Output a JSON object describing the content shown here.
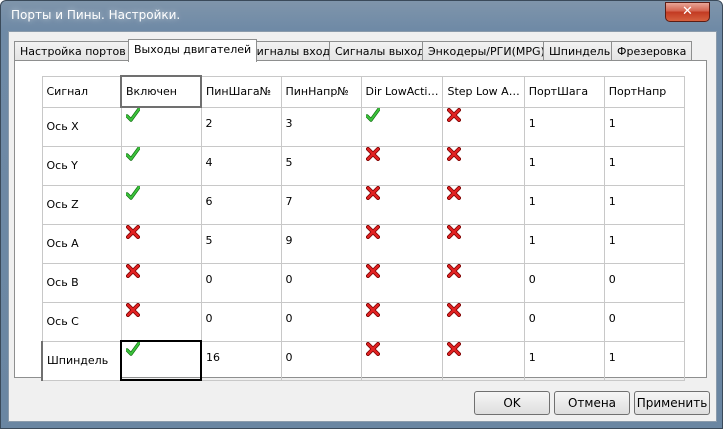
{
  "window": {
    "title": "Порты и Пины.  Настройки.",
    "close_label": "✕"
  },
  "tabs": [
    {
      "label": "Настройка портов",
      "active": false
    },
    {
      "label": "Выходы двигателей",
      "active": true
    },
    {
      "label": "Сигналы входа",
      "active": false
    },
    {
      "label": "Сигналы выхода",
      "active": false
    },
    {
      "label": "Энкодеры/РГИ(MPG)",
      "active": false
    },
    {
      "label": "Шпиндель",
      "active": false
    },
    {
      "label": "Фрезеровка",
      "active": false
    }
  ],
  "table": {
    "columns": [
      "Сигнал",
      "Включен",
      "ПинШага№",
      "ПинНапр№",
      "Dir LowActi…",
      "Step Low A…",
      "ПортШага",
      "ПортНапр"
    ],
    "rows": [
      {
        "signal": "Ось X",
        "enabled": true,
        "step_pin": "2",
        "dir_pin": "3",
        "dir_low": true,
        "step_low": false,
        "step_port": "1",
        "dir_port": "1"
      },
      {
        "signal": "Ось Y",
        "enabled": true,
        "step_pin": "4",
        "dir_pin": "5",
        "dir_low": false,
        "step_low": false,
        "step_port": "1",
        "dir_port": "1"
      },
      {
        "signal": "Ось Z",
        "enabled": true,
        "step_pin": "6",
        "dir_pin": "7",
        "dir_low": false,
        "step_low": false,
        "step_port": "1",
        "dir_port": "1"
      },
      {
        "signal": "Ось A",
        "enabled": false,
        "step_pin": "5",
        "dir_pin": "9",
        "dir_low": false,
        "step_low": false,
        "step_port": "1",
        "dir_port": "1"
      },
      {
        "signal": "Ось B",
        "enabled": false,
        "step_pin": "0",
        "dir_pin": "0",
        "dir_low": false,
        "step_low": false,
        "step_port": "0",
        "dir_port": "0"
      },
      {
        "signal": "Ось C",
        "enabled": false,
        "step_pin": "0",
        "dir_pin": "0",
        "dir_low": false,
        "step_low": false,
        "step_port": "0",
        "dir_port": "0"
      },
      {
        "signal": "Шпиндель",
        "enabled": true,
        "step_pin": "16",
        "dir_pin": "0",
        "dir_low": false,
        "step_low": false,
        "step_port": "1",
        "dir_port": "1"
      }
    ]
  },
  "buttons": {
    "ok": "OK",
    "cancel": "Отмена",
    "apply": "Применить"
  },
  "icons": {
    "yes": "green-check-icon",
    "no": "red-x-icon"
  },
  "colors": {
    "check": "#22aa22",
    "cross": "#cc1111"
  }
}
